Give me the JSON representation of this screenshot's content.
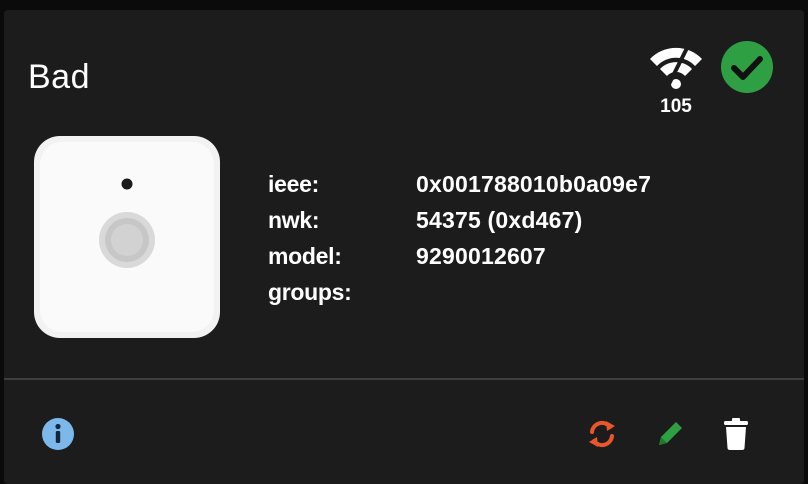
{
  "device": {
    "name": "Bad",
    "link_quality": "105",
    "status": "ok"
  },
  "details": [
    {
      "key": "ieee:",
      "value": "0x001788010b0a09e7"
    },
    {
      "key": "nwk:",
      "value": "54375 (0xd467)"
    },
    {
      "key": "model:",
      "value": "9290012607"
    },
    {
      "key": "groups:",
      "value": ""
    }
  ],
  "icons": {
    "link_quality": "wifi-signal-icon",
    "status": "check-circle-icon",
    "info": "info-icon",
    "reconfigure": "refresh-icon",
    "rename": "pencil-icon",
    "remove": "trash-icon"
  },
  "colors": {
    "card_bg": "#1c1c1c",
    "status_ok": "#2ea043",
    "info": "#7db8ea",
    "reconfigure": "#e8562a",
    "rename": "#2ea043",
    "remove": "#ffffff"
  }
}
